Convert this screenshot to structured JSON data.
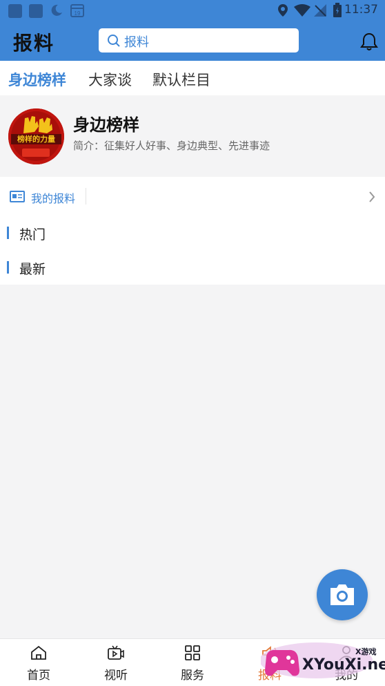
{
  "status_bar": {
    "time": "11:37",
    "calendar_day": "19"
  },
  "app_bar": {
    "title": "报料",
    "search_placeholder": "报料"
  },
  "tabs": [
    {
      "label": "身边榜样",
      "active": true
    },
    {
      "label": "大家谈",
      "active": false
    },
    {
      "label": "默认栏目",
      "active": false
    }
  ],
  "channel": {
    "name": "身边榜样",
    "description": "简介：征集好人好事、身边典型、先进事迹",
    "avatar_text": "榜样的力量"
  },
  "my_report": {
    "label": "我的报料"
  },
  "sections": [
    {
      "label": "热门"
    },
    {
      "label": "最新"
    }
  ],
  "bottom_nav": [
    {
      "label": "首页",
      "icon": "home-icon"
    },
    {
      "label": "视听",
      "icon": "video-icon"
    },
    {
      "label": "服务",
      "icon": "grid-icon"
    },
    {
      "label": "报料",
      "icon": "speaker-icon",
      "active": true
    },
    {
      "label": "我的",
      "icon": "user-icon"
    }
  ],
  "watermark": {
    "text": "XYouXi.net",
    "small": "X游戏"
  },
  "colors": {
    "primary": "#3e86d6",
    "active_nav": "#e37a3a",
    "background": "#f4f4f5"
  }
}
